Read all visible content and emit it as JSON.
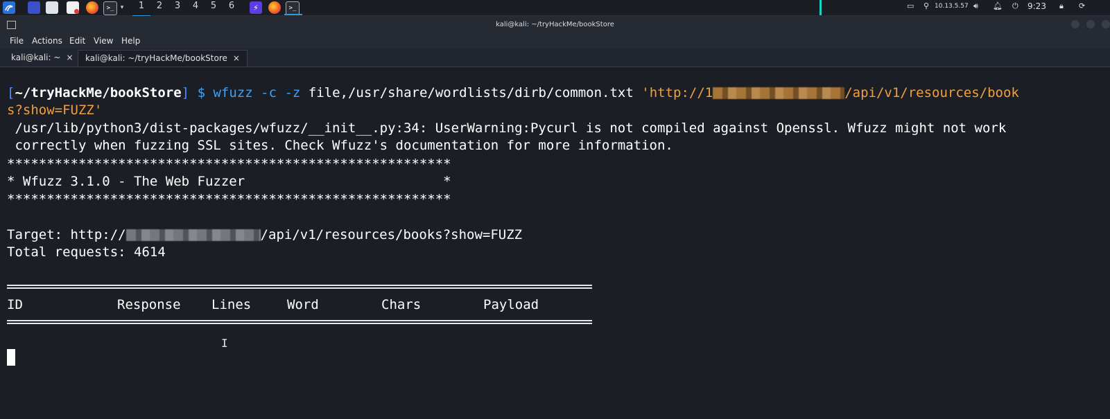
{
  "taskbar": {
    "workspaces": [
      "1",
      "2",
      "3",
      "4",
      "5",
      "6"
    ],
    "ip": "10.13.5.57",
    "time": "9:23"
  },
  "window": {
    "title": "kali@kali: ~/tryHackMe/bookStore"
  },
  "menu": [
    "File",
    "Actions",
    "Edit",
    "View",
    "Help"
  ],
  "tabs": [
    {
      "label": "kali@kali: ~",
      "close": "×"
    },
    {
      "label": "kali@kali: ~/tryHackMe/bookStore",
      "close": "×"
    }
  ],
  "terminal": {
    "prompt_open": "[",
    "prompt_path": "~/tryHackMe/bookStore",
    "prompt_close": "]",
    "prompt_symbol": "$",
    "cmd_program": "wfuzz",
    "cmd_flags": "-c -z",
    "cmd_arg": "file,/usr/share/wordlists/dirb/common.txt",
    "url_start": "'http://1",
    "url_end": "/api/v1/resources/book",
    "url_wrap": "s?show=FUZZ'",
    "warning_1": " /usr/lib/python3/dist-packages/wfuzz/__init__.py:34: UserWarning:Pycurl is not compiled against Openssl. Wfuzz might not work",
    "warning_2": " correctly when fuzzing SSL sites. Check Wfuzz's documentation for more information.",
    "banner_border": "********************************************************",
    "banner_text": "* Wfuzz 3.1.0 - The Web Fuzzer                         *",
    "target_prefix": "Target: http://",
    "target_suffix": "/api/v1/resources/books?show=FUZZ",
    "total_requests": "Total requests: 4614",
    "col_id": "ID",
    "col_response": "Response",
    "col_lines": "Lines",
    "col_word": "Word",
    "col_chars": "Chars",
    "col_payload": "Payload"
  },
  "colors": {
    "background": "#1b1e25",
    "prompt_bracket": "#4b8cff",
    "command": "#3fa2f6",
    "url": "#f2a03d"
  }
}
